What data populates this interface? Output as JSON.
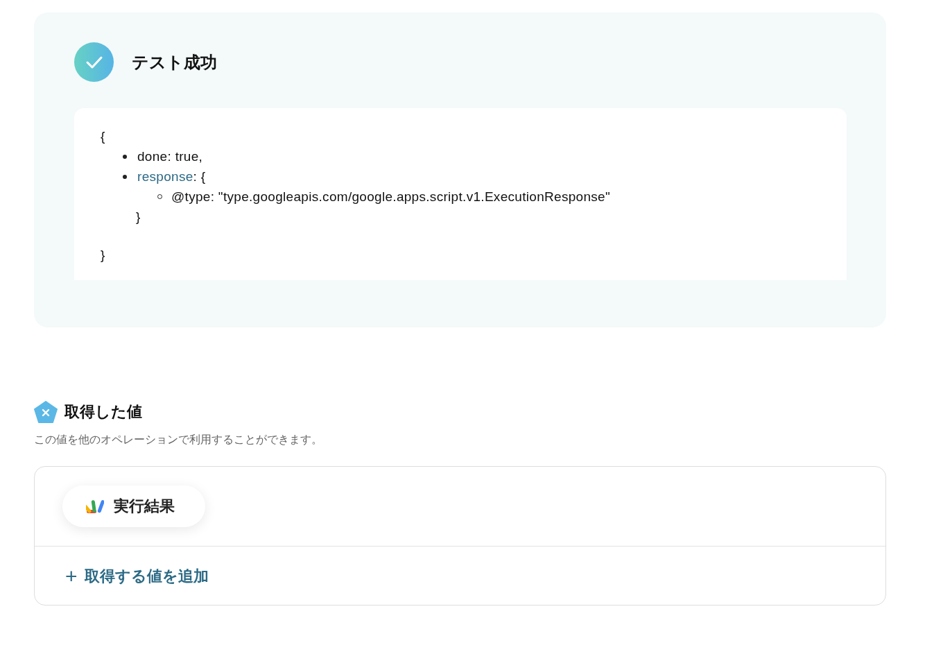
{
  "result": {
    "title": "テスト成功",
    "lines": [
      {
        "kind": "brace",
        "text": "{"
      },
      {
        "kind": "bullet",
        "text": "done: true,"
      },
      {
        "kind": "bullet",
        "key": "response",
        "text": ": {"
      },
      {
        "kind": "sub_bullet",
        "text": "@type: \"type.googleapis.com/google.apps.script.v1.ExecutionResponse\""
      },
      {
        "kind": "inner_close",
        "text": "}"
      },
      {
        "kind": "blank"
      },
      {
        "kind": "brace",
        "text": "}"
      }
    ]
  },
  "values": {
    "title": "取得した値",
    "description": "この値を他のオペレーションで利用することができます。",
    "chips": [
      {
        "label": "実行結果"
      }
    ],
    "add_link": {
      "icon": "+",
      "label": "取得する値を追加"
    }
  }
}
